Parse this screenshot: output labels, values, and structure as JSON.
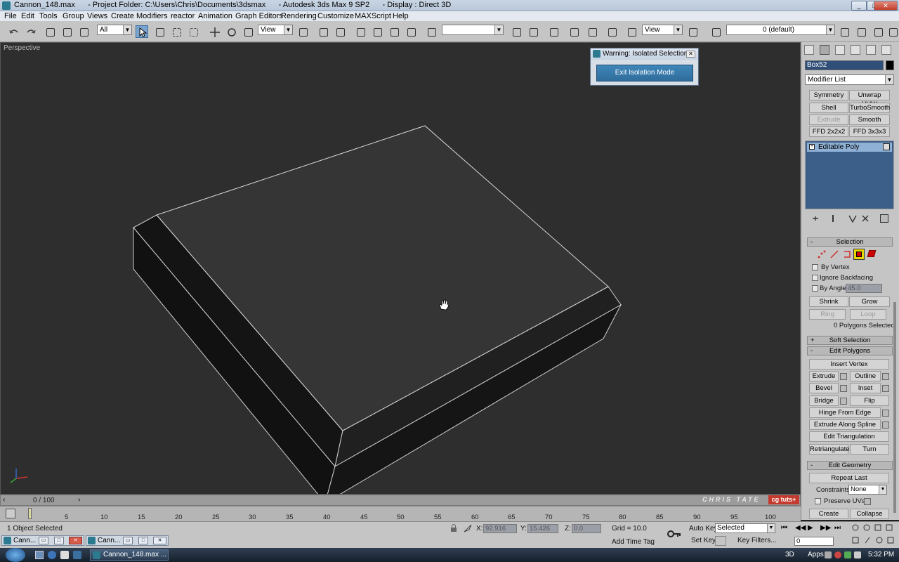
{
  "window": {
    "title": "Cannon_148.max      - Project Folder: C:\\Users\\Chris\\Documents\\3dsmax      - Autodesk 3ds Max 9 SP2      - Display : Direct 3D"
  },
  "menu": [
    "File",
    "Edit",
    "Tools",
    "Group",
    "Views",
    "Create",
    "Modifiers",
    "reactor",
    "Animation",
    "Graph Editors",
    "Rendering",
    "Customize",
    "MAXScript",
    "Help"
  ],
  "toolbar": {
    "selection_filter": "All",
    "ref_coord": "View",
    "ref_coord2": "View",
    "named_sel": "",
    "layer": "0 (default)"
  },
  "viewport": {
    "label": "Perspective"
  },
  "warning": {
    "title": "Warning: Isolated Selection",
    "button": "Exit Isolation Mode"
  },
  "command_panel": {
    "object_name": "Box52",
    "modifier_list": "Modifier List",
    "mod_buttons": [
      "Symmetry",
      "Unwrap UVW",
      "Shell",
      "TurboSmooth",
      "Extrude",
      "Smooth",
      "FFD 2x2x2",
      "FFD 3x3x3"
    ],
    "stack_item": "Editable Poly",
    "selection": {
      "title": "Selection",
      "by_vertex": "By Vertex",
      "ignore_backfacing": "Ignore Backfacing",
      "by_angle": "By Angle:",
      "angle_value": "45.0",
      "shrink": "Shrink",
      "grow": "Grow",
      "ring": "Ring",
      "loop": "Loop",
      "status": "0 Polygons Selected"
    },
    "soft_selection": "Soft Selection",
    "edit_polygons": {
      "title": "Edit Polygons",
      "insert_vertex": "Insert Vertex",
      "extrude": "Extrude",
      "outline": "Outline",
      "bevel": "Bevel",
      "inset": "Inset",
      "bridge": "Bridge",
      "flip": "Flip",
      "hinge": "Hinge From Edge",
      "extrude_spline": "Extrude Along Spline",
      "edit_tri": "Edit Triangulation",
      "retriangulate": "Retriangulate",
      "turn": "Turn"
    },
    "edit_geometry": {
      "title": "Edit Geometry",
      "repeat_last": "Repeat Last",
      "constraints_label": "Constraints:",
      "constraints_value": "None",
      "preserve_uvs": "Preserve UVs",
      "create": "Create",
      "collapse": "Collapse"
    }
  },
  "timeline": {
    "frame_display": "0 / 100",
    "ticks": [
      "5",
      "10",
      "15",
      "20",
      "25",
      "30",
      "35",
      "40",
      "45",
      "50",
      "55",
      "60",
      "65",
      "70",
      "75",
      "80",
      "85",
      "90",
      "95",
      "100"
    ]
  },
  "watermark": "CHRIS TATE",
  "logo": "cg tuts+",
  "status": {
    "selected": "1 Object Selected",
    "x_label": "X:",
    "x_value": "92.916",
    "y_label": "Y:",
    "y_value": "15.426",
    "z_label": "Z:",
    "z_value": "0.0",
    "grid": "Grid = 10.0",
    "add_time_tag": "Add Time Tag",
    "auto_key": "Auto Key",
    "key_mode": "Selected",
    "set_key": "Set Key",
    "key_filters": "Key Filters...",
    "frame": "0"
  },
  "minimized": [
    "Cann...",
    "Cann..."
  ],
  "taskbar": {
    "task": "Cannon_148.max ...",
    "tray_3d": "3D",
    "apps": "Apps",
    "clock": "5:32 PM"
  }
}
